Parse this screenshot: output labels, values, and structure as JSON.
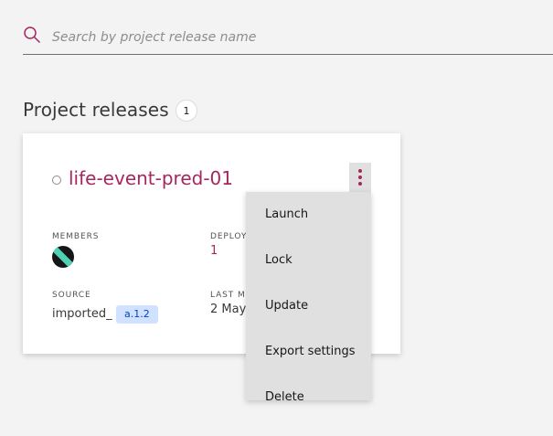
{
  "search": {
    "placeholder": "Search by project release name",
    "icon": "search-icon"
  },
  "section": {
    "title": "Project releases",
    "count": "1"
  },
  "release": {
    "name": "life-event-pred-01",
    "members_label": "MEMBERS",
    "deployments_label": "DEPLOY",
    "deployments_value": "1",
    "source_label": "SOURCE",
    "source_value": "imported_",
    "version": "a.1.2",
    "last_modified_label": "LAST M",
    "last_modified_value": "2 May"
  },
  "menu": {
    "items": [
      "Launch",
      "Lock",
      "Update",
      "Export settings",
      "Delete"
    ]
  },
  "colors": {
    "accent": "#a6265f",
    "tag_bg": "#d0e2ff",
    "tag_text": "#0043ce",
    "menu_bg": "#e0e0e0"
  }
}
